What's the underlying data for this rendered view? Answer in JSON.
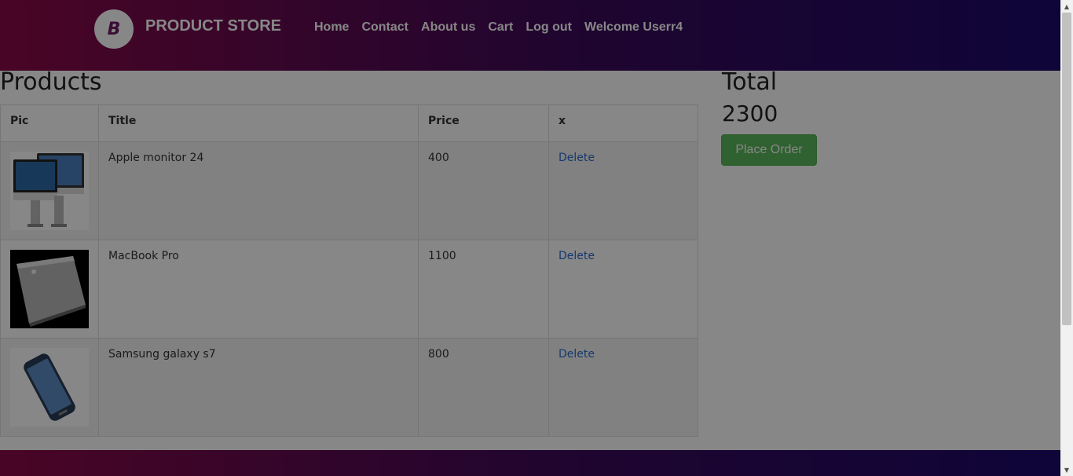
{
  "brand": {
    "logo_letter": "B",
    "name": "PRODUCT STORE"
  },
  "nav": {
    "items": [
      "Home",
      "Contact",
      "About us",
      "Cart",
      "Log out",
      "Welcome Userr4"
    ]
  },
  "products": {
    "heading": "Products",
    "columns": [
      "Pic",
      "Title",
      "Price",
      "x"
    ],
    "rows": [
      {
        "image": "apple-monitor-image",
        "title": "Apple monitor 24",
        "price": "400",
        "action": "Delete"
      },
      {
        "image": "macbook-pro-image",
        "title": "MacBook Pro",
        "price": "1100",
        "action": "Delete"
      },
      {
        "image": "samsung-galaxy-s7-image",
        "title": "Samsung galaxy s7",
        "price": "800",
        "action": "Delete"
      }
    ]
  },
  "total": {
    "label": "Total",
    "value": "2300",
    "button": "Place Order"
  },
  "colors": {
    "navbar_gradient": [
      "#8b0a47",
      "#3a0a5a",
      "#1c0b6b"
    ],
    "button_green": "#5cb85c",
    "link_blue": "#2a6cd3",
    "modal_overlay": "rgba(0,0,0,0.47)"
  }
}
